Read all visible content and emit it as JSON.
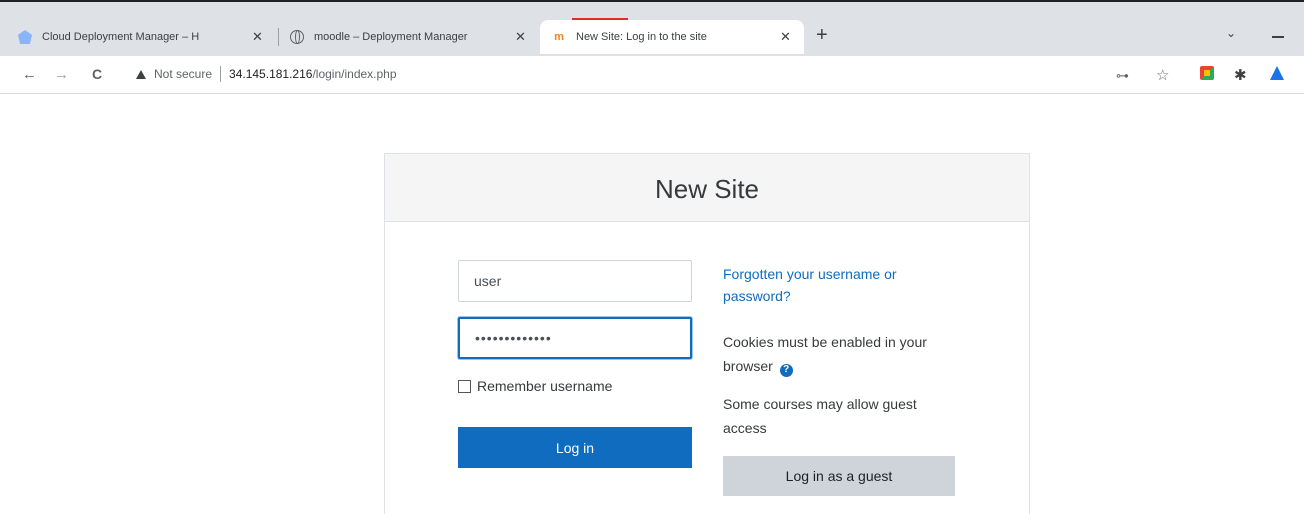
{
  "browser": {
    "tabs": [
      {
        "title": "Cloud Deployment Manager – H",
        "icon": "cloud-deployment-icon",
        "active": false
      },
      {
        "title": "moodle – Deployment Manager",
        "icon": "globe-icon",
        "active": false
      },
      {
        "title": "New Site: Log in to the site",
        "icon": "moodle-icon",
        "active": true
      }
    ],
    "close_glyph": "✕",
    "new_tab_glyph": "+",
    "tab_search_glyph": "⌄",
    "nav": {
      "back": "←",
      "forward": "→",
      "reload": "C"
    },
    "address": {
      "security_label": "Not secure",
      "host": "34.145.181.216",
      "path": "/login/index.php"
    },
    "toolbar_icons": {
      "key": "⊶",
      "star": "☆",
      "puzzle": "✱"
    }
  },
  "login": {
    "site_name": "New Site",
    "username_value": "user",
    "password_value": "•••••••••••••",
    "remember_label": "Remember username",
    "login_button": "Log in",
    "forgot_link": "Forgotten your username or password?",
    "cookies_text": "Cookies must be enabled in your browser",
    "help_glyph": "?",
    "guest_text": "Some courses may allow guest access",
    "guest_button": "Log in as a guest"
  },
  "colors": {
    "primary": "#0f6cbf",
    "secondary_button": "#ced4da",
    "header_bg": "#f5f5f5",
    "tabstrip_bg": "#dee1e6",
    "loading_indicator": "#d93025"
  }
}
